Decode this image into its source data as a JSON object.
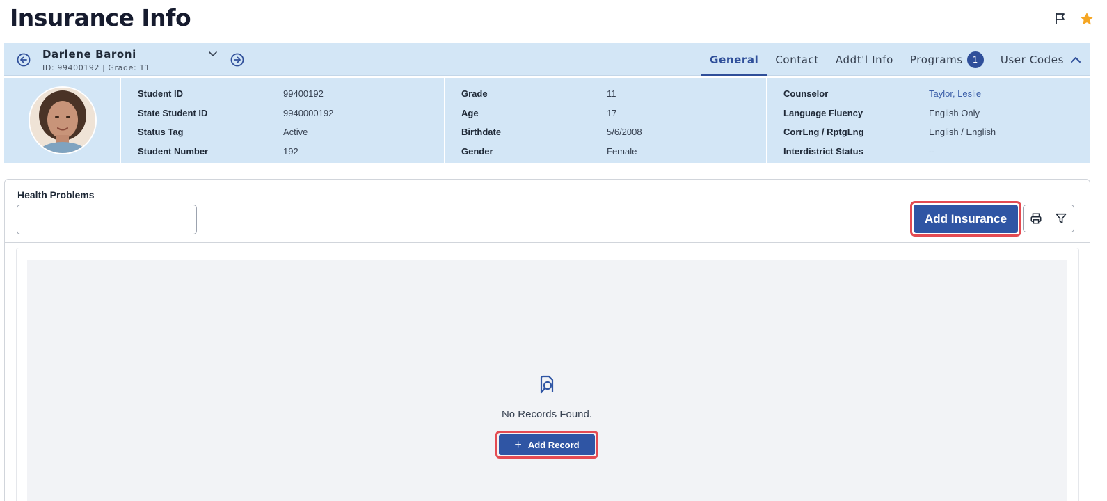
{
  "page": {
    "title": "Insurance Info"
  },
  "header_icons": [
    {
      "name": "flag-icon"
    },
    {
      "name": "star-icon",
      "color": "#f5a623"
    }
  ],
  "student": {
    "name": "Darlene Baroni",
    "id_text": "ID: 99400192",
    "grade_text": "Grade: 11",
    "separator": "|"
  },
  "tabs": [
    {
      "label": "General",
      "active": true
    },
    {
      "label": "Contact"
    },
    {
      "label": "Addt'l Info"
    },
    {
      "label": "Programs",
      "badge": "1"
    },
    {
      "label": "User Codes"
    }
  ],
  "info": {
    "col1": [
      {
        "label": "Student ID",
        "value": "99400192"
      },
      {
        "label": "State Student ID",
        "value": "9940000192"
      },
      {
        "label": "Status Tag",
        "value": "Active"
      },
      {
        "label": "Student Number",
        "value": "192"
      }
    ],
    "col2": [
      {
        "label": "Grade",
        "value": "11"
      },
      {
        "label": "Age",
        "value": "17"
      },
      {
        "label": "Birthdate",
        "value": "5/6/2008"
      },
      {
        "label": "Gender",
        "value": "Female"
      }
    ],
    "col3": [
      {
        "label": "Counselor",
        "value": "Taylor, Leslie"
      },
      {
        "label": "Language Fluency",
        "value": "English Only"
      },
      {
        "label": "CorrLng / RptgLng",
        "value": "English / English"
      },
      {
        "label": "Interdistrict Status",
        "value": "--"
      }
    ]
  },
  "health": {
    "label": "Health Problems",
    "value": ""
  },
  "toolbar": {
    "add_insurance_label": "Add Insurance"
  },
  "empty_state": {
    "message": "No Records Found.",
    "add_record_label": "Add Record"
  },
  "colors": {
    "accent": "#2f55a4",
    "highlight": "#e44b52",
    "bar_bg": "#d3e6f6"
  }
}
